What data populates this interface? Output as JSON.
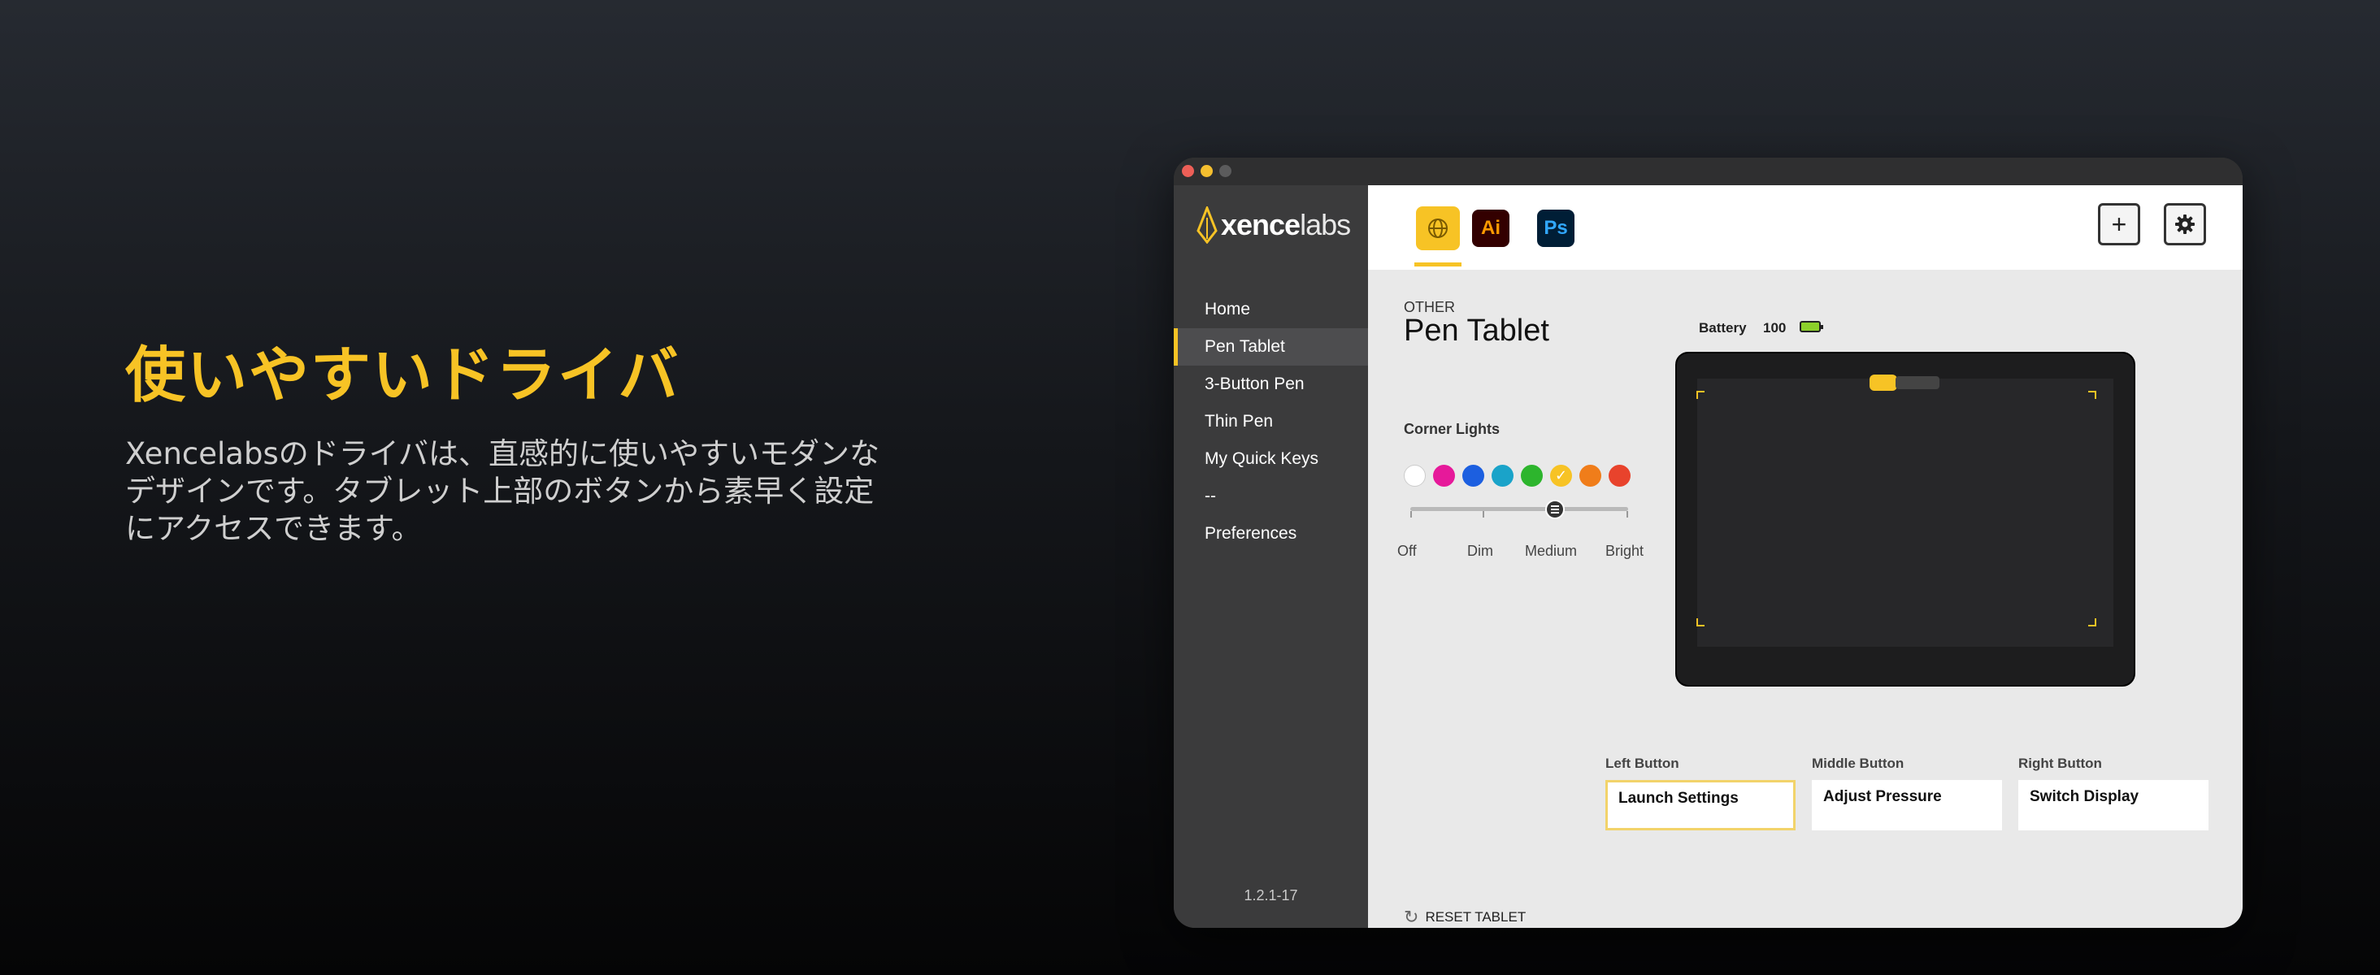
{
  "hero": {
    "title": "使いやすいドライバ",
    "description": "Xencelabsのドライバは、直感的に使いやすいモダンなデザインです。タブレット上部のボタンから素早く設定にアクセスできます。"
  },
  "window": {
    "traffic_lights": [
      "#ed5f57",
      "#f5bf2f",
      "#5b5b5c"
    ]
  },
  "sidebar": {
    "logo": {
      "bold": "xence",
      "light": "labs",
      "icon": "xencelabs-pen-nib-icon"
    },
    "items": [
      {
        "label": "Home",
        "active": false
      },
      {
        "label": "Pen Tablet",
        "active": true
      },
      {
        "label": "3-Button Pen",
        "active": false
      },
      {
        "label": "Thin Pen",
        "active": false
      },
      {
        "label": "My Quick Keys",
        "active": false
      },
      {
        "label": "--",
        "active": false
      },
      {
        "label": "Preferences",
        "active": false
      }
    ],
    "version": "1.2.1-17"
  },
  "toolbar": {
    "app_tabs": [
      {
        "name": "global",
        "icon": "globe-icon",
        "active": true
      },
      {
        "name": "Adobe Illustrator",
        "label": "Ai"
      },
      {
        "name": "Adobe Photoshop",
        "label": "Ps"
      }
    ],
    "add_label": "+",
    "settings_icon": "gear-icon"
  },
  "device": {
    "category": "OTHER",
    "title": "Pen Tablet",
    "battery_label": "Battery",
    "battery_value": "100"
  },
  "corner_lights": {
    "label": "Corner Lights",
    "colors": [
      "#ffffff",
      "#e6199a",
      "#1c5fe0",
      "#1aa3c9",
      "#2db52d",
      "#f7c325",
      "#f07d1a",
      "#e8432c"
    ],
    "selected_color": "#f7c325",
    "brightness_levels": [
      "Off",
      "Dim",
      "Medium",
      "Bright"
    ],
    "brightness_selected": "Medium"
  },
  "tablet_buttons": {
    "left": {
      "label": "Left Button",
      "value": "Launch Settings",
      "selected": true
    },
    "middle": {
      "label": "Middle Button",
      "value": "Adjust Pressure",
      "selected": false
    },
    "right": {
      "label": "Right Button",
      "value": "Switch Display",
      "selected": false
    }
  },
  "reset_label": "RESET TABLET",
  "colors": {
    "accent": "#f7c325",
    "sidebar_bg": "#3b3b3c",
    "content_bg": "#e9e9e9"
  }
}
